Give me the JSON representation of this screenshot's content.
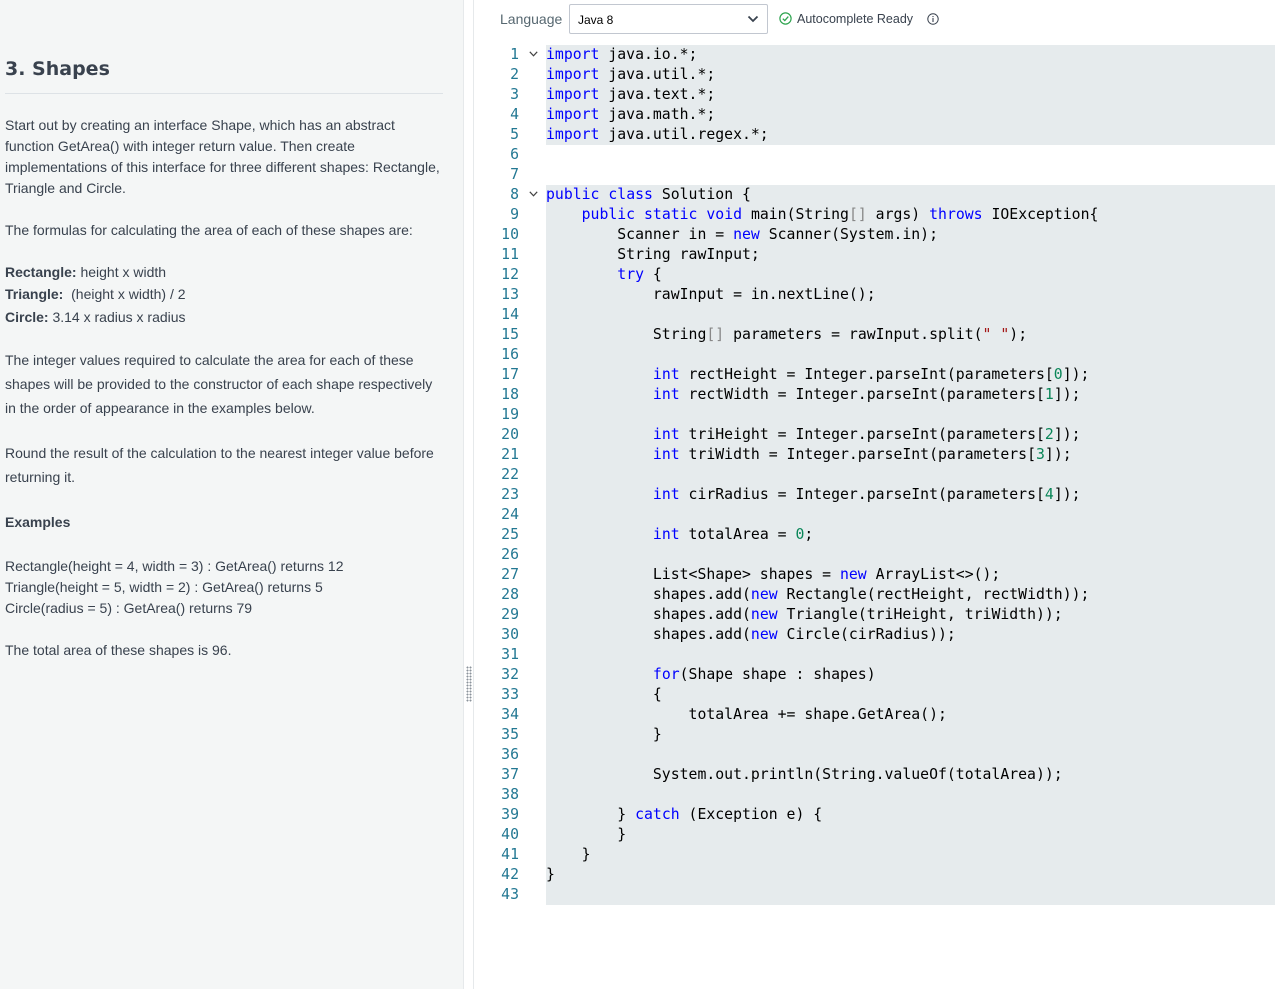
{
  "problem": {
    "title": "3. Shapes",
    "intro_lines": [
      "Start out by creating an interface Shape, which has an abstract",
      "function GetArea() with integer return value. Then create",
      "implementations of this interface for three different shapes: Rectangle,",
      "Triangle and Circle."
    ],
    "formulas_intro": "The formulas for calculating the area of each of these shapes are:",
    "formulas": [
      {
        "label": "Rectangle:",
        "text": " height x width"
      },
      {
        "label": "Triangle:",
        "text": "  (height x width) / 2"
      },
      {
        "label": "Circle:",
        "text": " 3.14 x radius x radius"
      }
    ],
    "constructor_lines": [
      "The integer values required to calculate the area for each of these",
      "shapes will be provided to the constructor of each shape respectively",
      "in the order of appearance in the examples below."
    ],
    "rounding_lines": [
      "Round the result of the calculation to the nearest integer value before",
      "returning it."
    ],
    "examples_heading": "Examples",
    "examples": [
      "Rectangle(height = 4, width = 3) : GetArea() returns 12",
      "Triangle(height = 5, width = 2) : GetArea() returns 5",
      "Circle(radius = 5) : GetArea() returns 79"
    ],
    "total": "The total area of these shapes is 96."
  },
  "toolbar": {
    "language_label": "Language",
    "language_value": "Java 8",
    "autocomplete_status": "Autocomplete Ready",
    "icons": [
      "chevron-down-icon",
      "check-circle-icon",
      "info-icon"
    ]
  },
  "colors": {
    "keyword": "#0000ff",
    "number": "#098658",
    "string": "#a31515",
    "line_number": "#237893",
    "highlight_bg": "#e6ebed",
    "status_check": "#2ea44f"
  },
  "editor": {
    "code": [
      "import java.io.*;",
      "import java.util.*;",
      "import java.text.*;",
      "import java.math.*;",
      "import java.util.regex.*;",
      "",
      "",
      "public class Solution {",
      "    public static void main(String[] args) throws IOException{",
      "        Scanner in = new Scanner(System.in);",
      "        String rawInput;",
      "        try {",
      "            rawInput = in.nextLine();",
      "",
      "            String[] parameters = rawInput.split(\" \");",
      "",
      "            int rectHeight = Integer.parseInt(parameters[0]);",
      "            int rectWidth = Integer.parseInt(parameters[1]);",
      "",
      "            int triHeight = Integer.parseInt(parameters[2]);",
      "            int triWidth = Integer.parseInt(parameters[3]);",
      "",
      "            int cirRadius = Integer.parseInt(parameters[4]);",
      "",
      "            int totalArea = 0;",
      "",
      "            List<Shape> shapes = new ArrayList<>();",
      "            shapes.add(new Rectangle(rectHeight, rectWidth));",
      "            shapes.add(new Triangle(triHeight, triWidth));",
      "            shapes.add(new Circle(cirRadius));",
      "",
      "            for(Shape shape : shapes)",
      "            {",
      "                totalArea += shape.GetArea();",
      "            }",
      "",
      "            System.out.println(String.valueOf(totalArea));",
      "",
      "        } catch (Exception e) {",
      "        }",
      "    }",
      "}",
      ""
    ],
    "fold_lines": [
      1,
      8
    ]
  }
}
